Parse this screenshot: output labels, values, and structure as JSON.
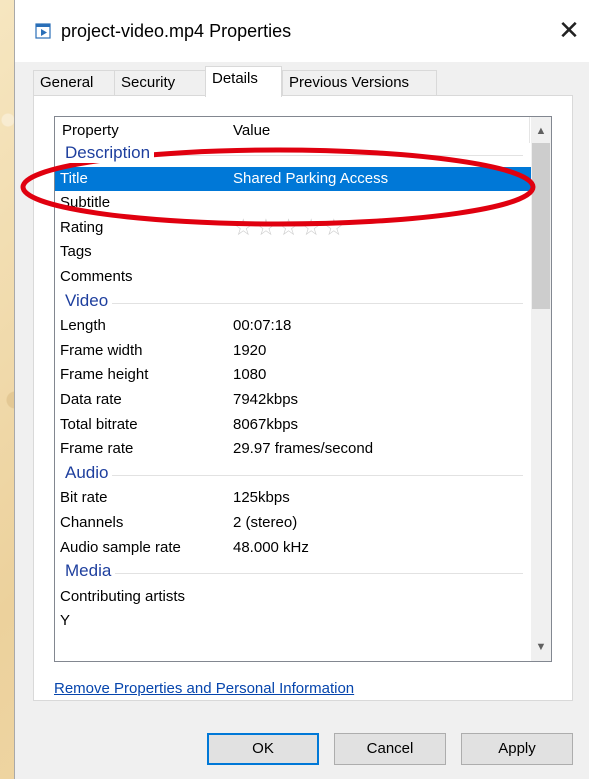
{
  "window": {
    "title": "project-video.mp4 Properties",
    "close_glyph": "✕"
  },
  "tabs": [
    {
      "label": "General",
      "active": false
    },
    {
      "label": "Security",
      "active": false
    },
    {
      "label": "Details",
      "active": true
    },
    {
      "label": "Previous Versions",
      "active": false
    }
  ],
  "list": {
    "col_property": "Property",
    "col_value": "Value",
    "groups": {
      "description": "Description",
      "video": "Video",
      "audio": "Audio",
      "media": "Media"
    },
    "description_rows": [
      {
        "key": "Title",
        "value": "Shared Parking Access"
      },
      {
        "key": "Subtitle",
        "value": ""
      },
      {
        "key": "Rating",
        "value": "",
        "rating_stars": 0
      },
      {
        "key": "Tags",
        "value": ""
      },
      {
        "key": "Comments",
        "value": ""
      }
    ],
    "video_rows": [
      {
        "key": "Length",
        "value": "00:07:18"
      },
      {
        "key": "Frame width",
        "value": "1920"
      },
      {
        "key": "Frame height",
        "value": "1080"
      },
      {
        "key": "Data rate",
        "value": "7942kbps"
      },
      {
        "key": "Total bitrate",
        "value": "8067kbps"
      },
      {
        "key": "Frame rate",
        "value": "29.97 frames/second"
      }
    ],
    "audio_rows": [
      {
        "key": "Bit rate",
        "value": "125kbps"
      },
      {
        "key": "Channels",
        "value": "2 (stereo)"
      },
      {
        "key": "Audio sample rate",
        "value": "48.000 kHz"
      }
    ],
    "media_rows": [
      {
        "key": "Contributing artists",
        "value": ""
      },
      {
        "key": "Y",
        "value": ""
      }
    ],
    "stars": "☆☆☆☆☆",
    "scroll_up": "▲",
    "scroll_down": "▼"
  },
  "links": {
    "remove_properties": "Remove Properties and Personal Information"
  },
  "buttons": {
    "ok": "OK",
    "cancel": "Cancel",
    "apply": "Apply"
  },
  "colors": {
    "selection": "#0078d7",
    "group_heading": "#1e3f9e",
    "annotation": "#e0000f"
  }
}
